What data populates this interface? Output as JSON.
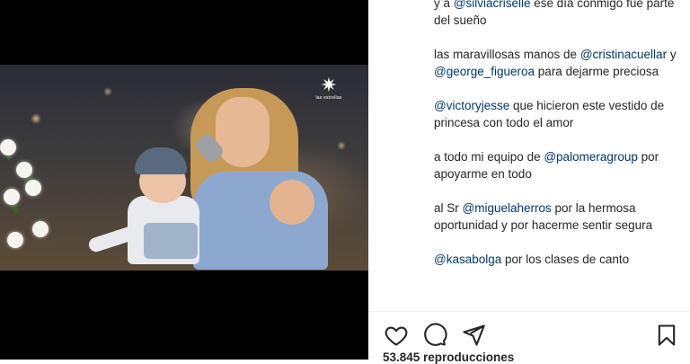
{
  "video": {
    "logo_text": "las estrellas",
    "logo_icon": "star-burst-icon"
  },
  "caption": {
    "p1_prefix": "y a ",
    "p1_mention": "@silviacriselle",
    "p1_suffix": " ese día conmigo fue parte del sueño",
    "p2_prefix": "las maravillosas manos de ",
    "p2_mention_a": "@cristinacuellar",
    "p2_middle": " y ",
    "p2_mention_b": "@george_figueroa",
    "p2_suffix": " para dejarme preciosa",
    "p3_mention": "@victoryjesse",
    "p3_suffix": " que hicieron este vestido de princesa con todo el amor",
    "p4_prefix": "a todo mi equipo de ",
    "p4_mention": "@palomeragroup",
    "p4_suffix": " por apoyarme en todo",
    "p5_prefix": "al Sr ",
    "p5_mention": "@miguelaherros",
    "p5_suffix": " por la hermosa oportunidad y por hacerme sentir segura",
    "p6_mention": "@kasabolga",
    "p6_suffix": " por los clases de canto"
  },
  "actions": {
    "like_icon": "heart-icon",
    "comment_icon": "comment-icon",
    "share_icon": "paper-plane-icon",
    "save_icon": "bookmark-icon"
  },
  "stats": {
    "views_label": "53.845 reproducciones"
  },
  "colors": {
    "mention": "#00376b",
    "text": "#262626",
    "media_bg": "#000000"
  }
}
